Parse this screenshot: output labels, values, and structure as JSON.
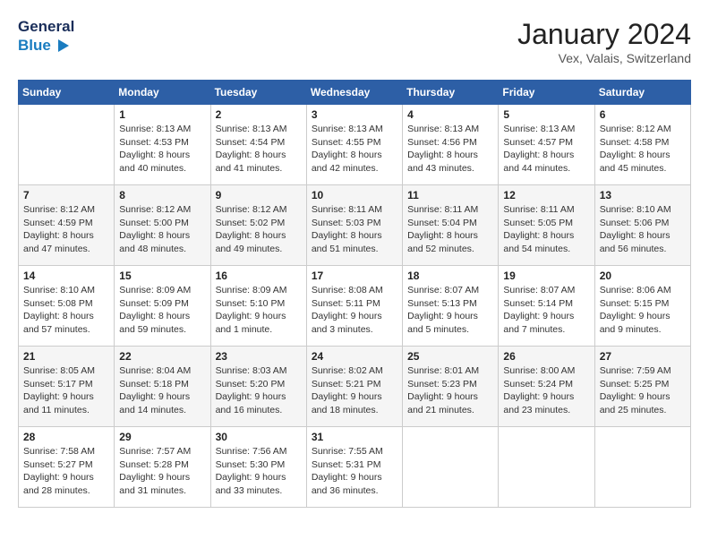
{
  "header": {
    "logo_line1": "General",
    "logo_line2": "Blue",
    "month": "January 2024",
    "location": "Vex, Valais, Switzerland"
  },
  "weekdays": [
    "Sunday",
    "Monday",
    "Tuesday",
    "Wednesday",
    "Thursday",
    "Friday",
    "Saturday"
  ],
  "weeks": [
    [
      {
        "day": "",
        "sunrise": "",
        "sunset": "",
        "daylight": ""
      },
      {
        "day": "1",
        "sunrise": "Sunrise: 8:13 AM",
        "sunset": "Sunset: 4:53 PM",
        "daylight": "Daylight: 8 hours and 40 minutes."
      },
      {
        "day": "2",
        "sunrise": "Sunrise: 8:13 AM",
        "sunset": "Sunset: 4:54 PM",
        "daylight": "Daylight: 8 hours and 41 minutes."
      },
      {
        "day": "3",
        "sunrise": "Sunrise: 8:13 AM",
        "sunset": "Sunset: 4:55 PM",
        "daylight": "Daylight: 8 hours and 42 minutes."
      },
      {
        "day": "4",
        "sunrise": "Sunrise: 8:13 AM",
        "sunset": "Sunset: 4:56 PM",
        "daylight": "Daylight: 8 hours and 43 minutes."
      },
      {
        "day": "5",
        "sunrise": "Sunrise: 8:13 AM",
        "sunset": "Sunset: 4:57 PM",
        "daylight": "Daylight: 8 hours and 44 minutes."
      },
      {
        "day": "6",
        "sunrise": "Sunrise: 8:12 AM",
        "sunset": "Sunset: 4:58 PM",
        "daylight": "Daylight: 8 hours and 45 minutes."
      }
    ],
    [
      {
        "day": "7",
        "sunrise": "Sunrise: 8:12 AM",
        "sunset": "Sunset: 4:59 PM",
        "daylight": "Daylight: 8 hours and 47 minutes."
      },
      {
        "day": "8",
        "sunrise": "Sunrise: 8:12 AM",
        "sunset": "Sunset: 5:00 PM",
        "daylight": "Daylight: 8 hours and 48 minutes."
      },
      {
        "day": "9",
        "sunrise": "Sunrise: 8:12 AM",
        "sunset": "Sunset: 5:02 PM",
        "daylight": "Daylight: 8 hours and 49 minutes."
      },
      {
        "day": "10",
        "sunrise": "Sunrise: 8:11 AM",
        "sunset": "Sunset: 5:03 PM",
        "daylight": "Daylight: 8 hours and 51 minutes."
      },
      {
        "day": "11",
        "sunrise": "Sunrise: 8:11 AM",
        "sunset": "Sunset: 5:04 PM",
        "daylight": "Daylight: 8 hours and 52 minutes."
      },
      {
        "day": "12",
        "sunrise": "Sunrise: 8:11 AM",
        "sunset": "Sunset: 5:05 PM",
        "daylight": "Daylight: 8 hours and 54 minutes."
      },
      {
        "day": "13",
        "sunrise": "Sunrise: 8:10 AM",
        "sunset": "Sunset: 5:06 PM",
        "daylight": "Daylight: 8 hours and 56 minutes."
      }
    ],
    [
      {
        "day": "14",
        "sunrise": "Sunrise: 8:10 AM",
        "sunset": "Sunset: 5:08 PM",
        "daylight": "Daylight: 8 hours and 57 minutes."
      },
      {
        "day": "15",
        "sunrise": "Sunrise: 8:09 AM",
        "sunset": "Sunset: 5:09 PM",
        "daylight": "Daylight: 8 hours and 59 minutes."
      },
      {
        "day": "16",
        "sunrise": "Sunrise: 8:09 AM",
        "sunset": "Sunset: 5:10 PM",
        "daylight": "Daylight: 9 hours and 1 minute."
      },
      {
        "day": "17",
        "sunrise": "Sunrise: 8:08 AM",
        "sunset": "Sunset: 5:11 PM",
        "daylight": "Daylight: 9 hours and 3 minutes."
      },
      {
        "day": "18",
        "sunrise": "Sunrise: 8:07 AM",
        "sunset": "Sunset: 5:13 PM",
        "daylight": "Daylight: 9 hours and 5 minutes."
      },
      {
        "day": "19",
        "sunrise": "Sunrise: 8:07 AM",
        "sunset": "Sunset: 5:14 PM",
        "daylight": "Daylight: 9 hours and 7 minutes."
      },
      {
        "day": "20",
        "sunrise": "Sunrise: 8:06 AM",
        "sunset": "Sunset: 5:15 PM",
        "daylight": "Daylight: 9 hours and 9 minutes."
      }
    ],
    [
      {
        "day": "21",
        "sunrise": "Sunrise: 8:05 AM",
        "sunset": "Sunset: 5:17 PM",
        "daylight": "Daylight: 9 hours and 11 minutes."
      },
      {
        "day": "22",
        "sunrise": "Sunrise: 8:04 AM",
        "sunset": "Sunset: 5:18 PM",
        "daylight": "Daylight: 9 hours and 14 minutes."
      },
      {
        "day": "23",
        "sunrise": "Sunrise: 8:03 AM",
        "sunset": "Sunset: 5:20 PM",
        "daylight": "Daylight: 9 hours and 16 minutes."
      },
      {
        "day": "24",
        "sunrise": "Sunrise: 8:02 AM",
        "sunset": "Sunset: 5:21 PM",
        "daylight": "Daylight: 9 hours and 18 minutes."
      },
      {
        "day": "25",
        "sunrise": "Sunrise: 8:01 AM",
        "sunset": "Sunset: 5:23 PM",
        "daylight": "Daylight: 9 hours and 21 minutes."
      },
      {
        "day": "26",
        "sunrise": "Sunrise: 8:00 AM",
        "sunset": "Sunset: 5:24 PM",
        "daylight": "Daylight: 9 hours and 23 minutes."
      },
      {
        "day": "27",
        "sunrise": "Sunrise: 7:59 AM",
        "sunset": "Sunset: 5:25 PM",
        "daylight": "Daylight: 9 hours and 25 minutes."
      }
    ],
    [
      {
        "day": "28",
        "sunrise": "Sunrise: 7:58 AM",
        "sunset": "Sunset: 5:27 PM",
        "daylight": "Daylight: 9 hours and 28 minutes."
      },
      {
        "day": "29",
        "sunrise": "Sunrise: 7:57 AM",
        "sunset": "Sunset: 5:28 PM",
        "daylight": "Daylight: 9 hours and 31 minutes."
      },
      {
        "day": "30",
        "sunrise": "Sunrise: 7:56 AM",
        "sunset": "Sunset: 5:30 PM",
        "daylight": "Daylight: 9 hours and 33 minutes."
      },
      {
        "day": "31",
        "sunrise": "Sunrise: 7:55 AM",
        "sunset": "Sunset: 5:31 PM",
        "daylight": "Daylight: 9 hours and 36 minutes."
      },
      {
        "day": "",
        "sunrise": "",
        "sunset": "",
        "daylight": ""
      },
      {
        "day": "",
        "sunrise": "",
        "sunset": "",
        "daylight": ""
      },
      {
        "day": "",
        "sunrise": "",
        "sunset": "",
        "daylight": ""
      }
    ]
  ]
}
